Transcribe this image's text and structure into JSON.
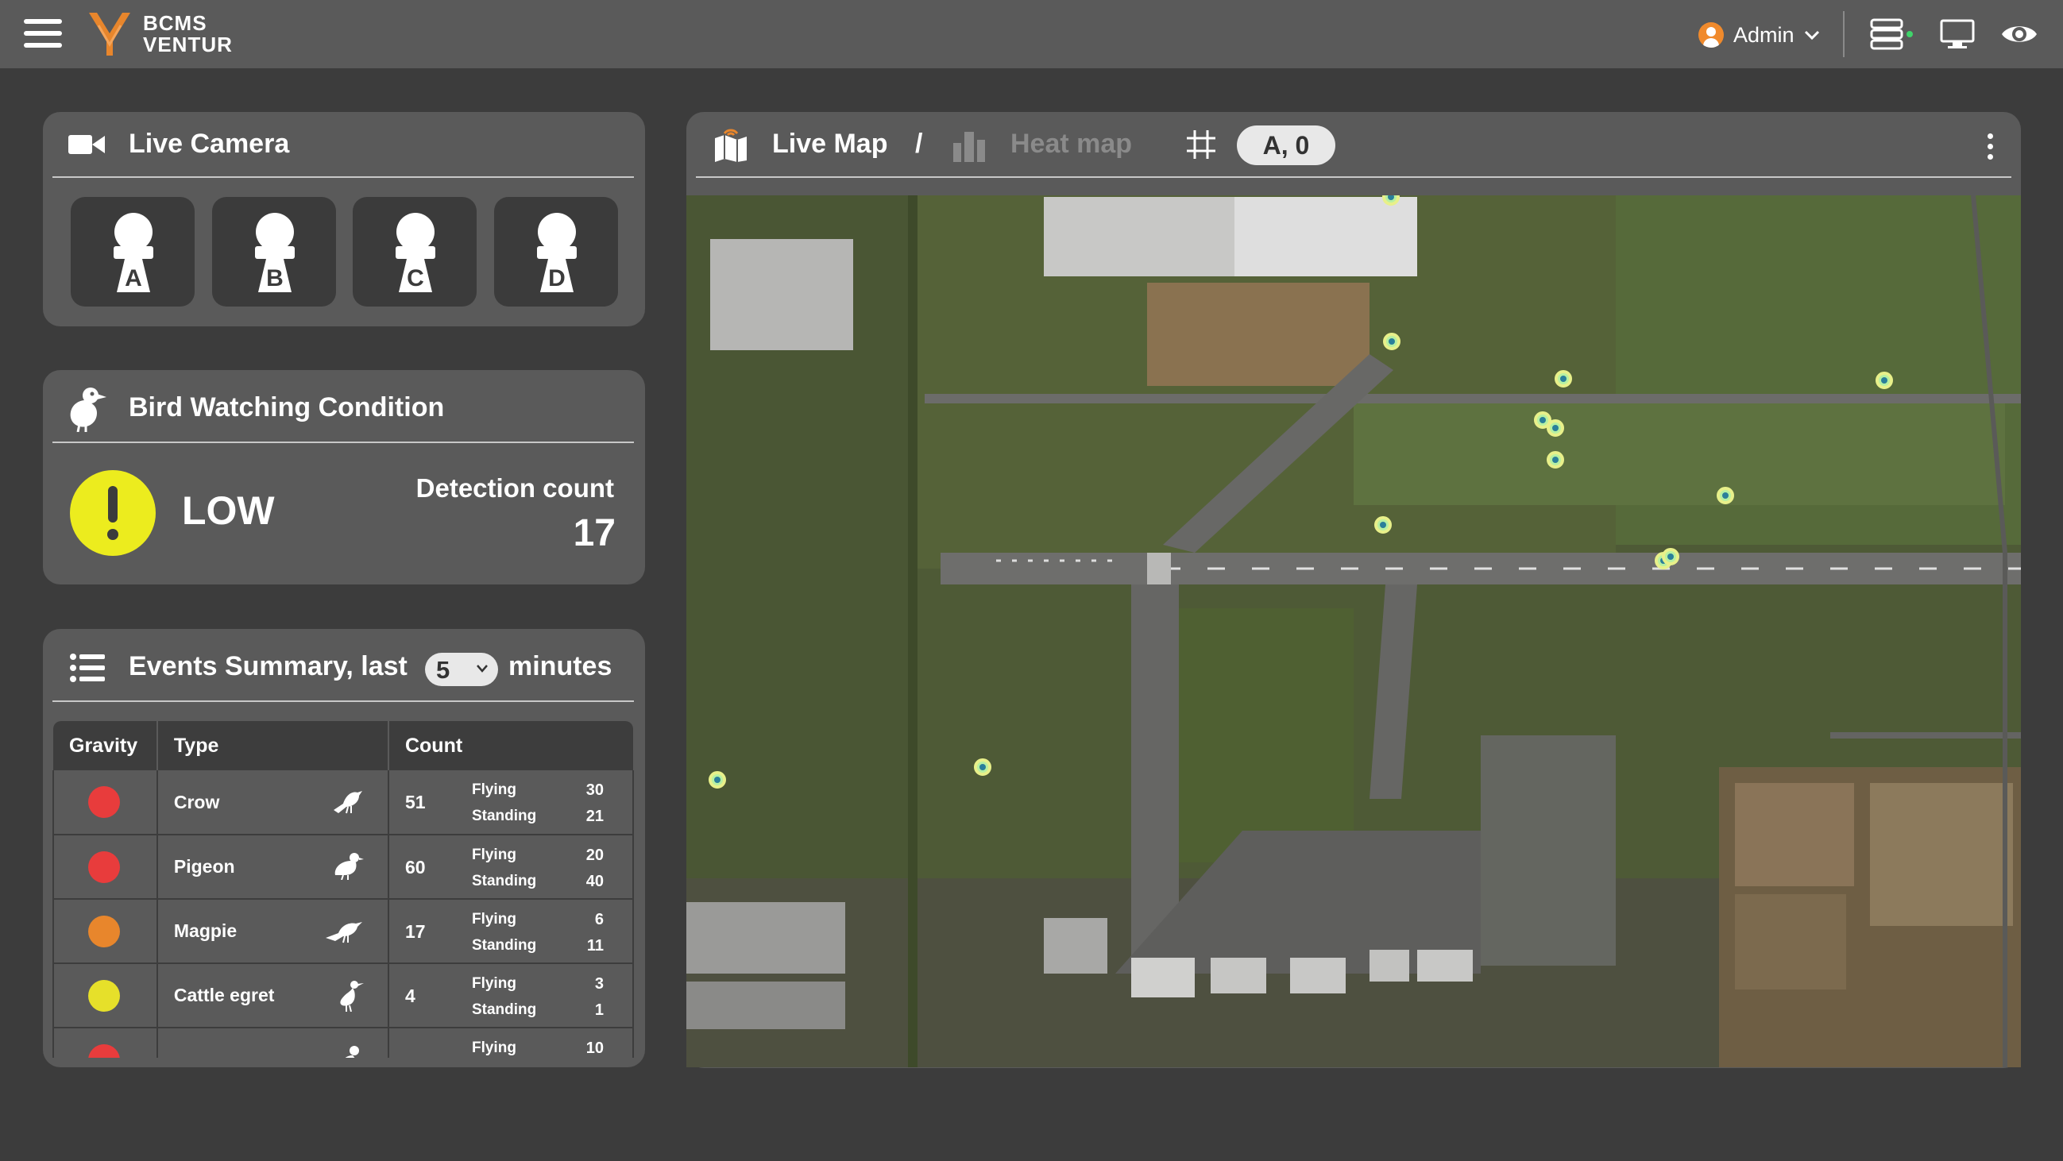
{
  "app": {
    "brand_line1": "BCMS",
    "brand_line2": "VENTUR",
    "user": "Admin"
  },
  "live_camera": {
    "title": "Live Camera",
    "cameras": [
      {
        "label": "A"
      },
      {
        "label": "B"
      },
      {
        "label": "C"
      },
      {
        "label": "D"
      }
    ]
  },
  "bird_watching": {
    "title": "Bird Watching Condition",
    "level": "LOW",
    "level_color": "#ecec1e",
    "detection_label": "Detection count",
    "detection_count": "17"
  },
  "events": {
    "title": "Events Summary, last",
    "minutes_value": "5",
    "minutes_suffix": "minutes",
    "columns": [
      "Gravity",
      "Type",
      "Count"
    ],
    "rows": [
      {
        "gravity_color": "#e83c3c",
        "type": "Crow",
        "icon": "crow-icon",
        "count": "51",
        "flying_label": "Flying",
        "flying": "30",
        "standing_label": "Standing",
        "standing": "21"
      },
      {
        "gravity_color": "#e83c3c",
        "type": "Pigeon",
        "icon": "pigeon-icon",
        "count": "60",
        "flying_label": "Flying",
        "flying": "20",
        "standing_label": "Standing",
        "standing": "40"
      },
      {
        "gravity_color": "#e8862c",
        "type": "Magpie",
        "icon": "magpie-icon",
        "count": "17",
        "flying_label": "Flying",
        "flying": "6",
        "standing_label": "Standing",
        "standing": "11"
      },
      {
        "gravity_color": "#e6e02a",
        "type": "Cattle egret",
        "icon": "egret-icon",
        "count": "4",
        "flying_label": "Flying",
        "flying": "3",
        "standing_label": "Standing",
        "standing": "1"
      },
      {
        "gravity_color": "#e83c3c",
        "type": "",
        "icon": "bird-icon",
        "count": "",
        "flying_label": "Flying",
        "flying": "10",
        "standing_label": "",
        "standing": ""
      }
    ]
  },
  "map": {
    "live_tab": "Live Map",
    "separator": "/",
    "heat_tab": "Heat map",
    "grid_coord": "A, 0"
  }
}
